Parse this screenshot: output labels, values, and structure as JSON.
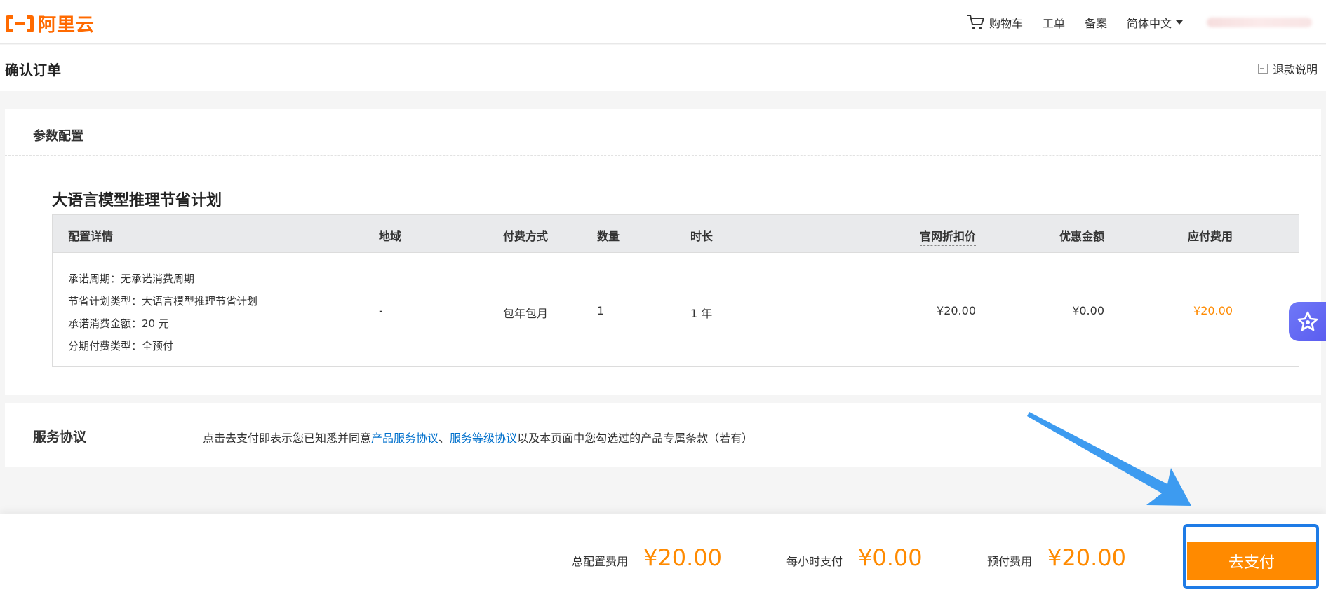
{
  "header": {
    "logo_text": "阿里云",
    "nav": {
      "cart": "购物车",
      "ticket": "工单",
      "filing": "备案",
      "language": "简体中文"
    }
  },
  "page": {
    "title": "确认订单",
    "refund_link": "退款说明"
  },
  "config": {
    "section_title": "参数配置",
    "product_name": "大语言模型推理节省计划",
    "columns": [
      "配置详情",
      "地域",
      "付费方式",
      "数量",
      "时长",
      "官网折扣价",
      "优惠金额",
      "应付费用"
    ],
    "row": {
      "details": [
        "承诺周期：无承诺消费周期",
        "节省计划类型：大语言模型推理节省计划",
        "承诺消费金额：20 元",
        "分期付费类型：全预付"
      ],
      "region": "-",
      "billing": "包年包月",
      "quantity": "1",
      "duration": "1 年",
      "list_price": "¥20.00",
      "discount": "¥0.00",
      "payable": "¥20.00"
    }
  },
  "agreement": {
    "title": "服务协议",
    "text_before": "点击去支付即表示您已知悉并同意",
    "link1": "产品服务协议",
    "sep": "、",
    "link2": "服务等级协议",
    "text_after": "以及本页面中您勾选过的产品专属条款（若有）"
  },
  "footer": {
    "total_label": "总配置费用",
    "total_amount": "¥20.00",
    "hourly_label": "每小时支付",
    "hourly_amount": "¥0.00",
    "prepay_label": "预付费用",
    "prepay_amount": "¥20.00",
    "pay_button": "去支付"
  },
  "colors": {
    "brand_orange": "#ff6a00",
    "price_orange": "#ff8a00",
    "link_blue": "#0070cc",
    "highlight_blue": "#1e7be6",
    "arrow_blue": "#3d9bf0"
  },
  "icons": {
    "cart": "cart-icon",
    "refund": "refund-icon",
    "assistant": "assistant-icon",
    "arrow": "annotation-arrow"
  }
}
